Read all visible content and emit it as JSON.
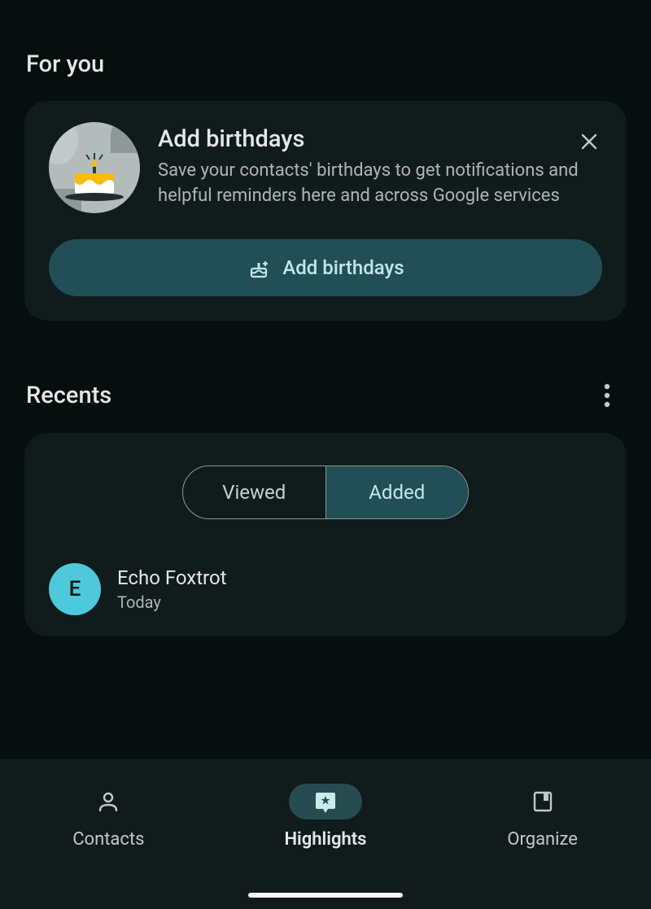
{
  "for_you": {
    "header": "For you",
    "birthday_card": {
      "title": "Add birthdays",
      "description": "Save your contacts' birthdays to get notifications and helpful reminders here and across Google services",
      "button_label": "Add birthdays"
    }
  },
  "recents": {
    "header": "Recents",
    "tabs": {
      "viewed": "Viewed",
      "added": "Added"
    },
    "contact": {
      "initial": "E",
      "name": "Echo Foxtrot",
      "meta": "Today"
    }
  },
  "nav": {
    "contacts": "Contacts",
    "highlights": "Highlights",
    "organize": "Organize"
  }
}
